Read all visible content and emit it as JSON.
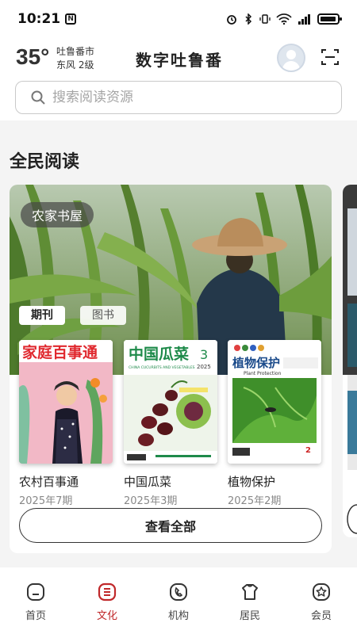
{
  "status_bar": {
    "time": "10:21",
    "nfc_glyph": "N"
  },
  "header": {
    "temperature": "35°",
    "city": "吐鲁番市",
    "wind": "东风  2级",
    "brand": "数字吐鲁番",
    "search_placeholder": "搜索阅读资源"
  },
  "section": {
    "title": "全民阅读"
  },
  "card": {
    "badge": "农家书屋",
    "tabs": [
      "期刊",
      "图书"
    ],
    "books": [
      {
        "name": "农村百事通",
        "issue": "2025年7期",
        "cover_title": "家庭百事通"
      },
      {
        "name": "中国瓜菜",
        "issue": "2025年3期",
        "cover_title": "中国瓜菜",
        "cover_number": "3",
        "cover_year": "2025",
        "cover_subtitle": "CHINA CUCURBITS AND VEGETABLES"
      },
      {
        "name": "植物保护",
        "issue": "2025年2期",
        "cover_title": "植物保护",
        "cover_number": "2",
        "cover_subtitle": "Plant Protection"
      }
    ],
    "view_all": "查看全部"
  },
  "bottom_nav": {
    "items": [
      {
        "label": "首页",
        "icon": "home-icon"
      },
      {
        "label": "文化",
        "icon": "culture-icon"
      },
      {
        "label": "机构",
        "icon": "institution-icon"
      },
      {
        "label": "居民",
        "icon": "resident-icon"
      },
      {
        "label": "会员",
        "icon": "member-icon"
      }
    ],
    "active_index": 1
  },
  "colors": {
    "accent": "#c0282a",
    "card_bg": "#ffffff",
    "page_bg": "#f4f4f4"
  }
}
